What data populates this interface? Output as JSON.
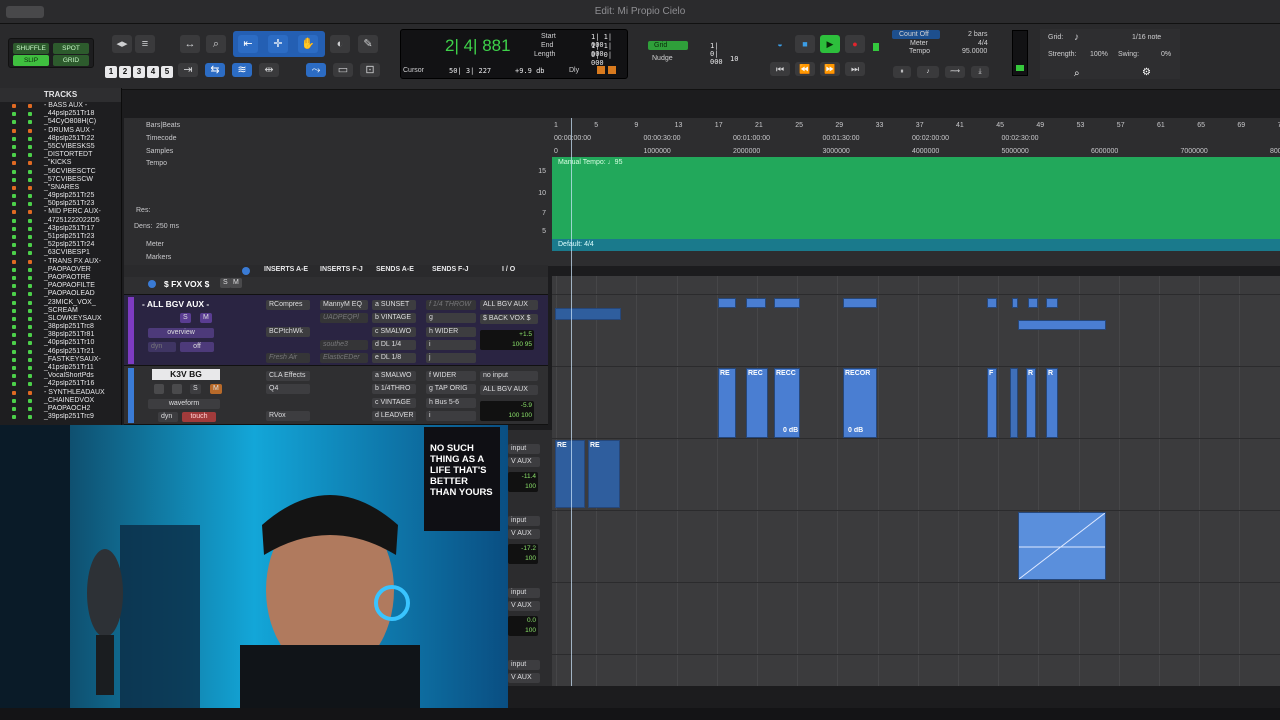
{
  "window": {
    "title": "Edit: Mi Propio Cielo"
  },
  "toolbar": {
    "modes": [
      "SHUFFLE",
      "SPOT",
      "SLIP",
      "GRID"
    ],
    "zoom_presets": [
      "1",
      "2",
      "3",
      "4",
      "5"
    ],
    "counter": {
      "main": "2| 4| 881",
      "cursor_label": "Cursor",
      "cursor_value": "50| 3| 227",
      "start_label": "Start",
      "start_value": "1| 1| 000",
      "end_label": "End",
      "end_value": "1| 1| 000",
      "length_label": "Length",
      "length_value": "0| 0| 000",
      "db_value": "+9.9 db",
      "dly_label": "Dly"
    },
    "grid": {
      "label": "Grid",
      "value": "1| 0| 000",
      "nudge_label": "Nudge",
      "nudge_value": "10"
    },
    "transport": {
      "count_off": "Count Off",
      "meter_label": "Meter",
      "tempo_label": "Tempo",
      "bars": "2 bars",
      "meter": "4/4",
      "tempo": "95.0000"
    },
    "grid_panel": {
      "grid_label": "Grid:",
      "grid_value": "1/16 note",
      "strength_label": "Strength:",
      "strength_value": "100%",
      "swing_label": "Swing:",
      "swing_value": "0%"
    }
  },
  "tracks_panel": {
    "title": "TRACKS",
    "items": [
      "- BASS AUX -",
      "_44pslp251Tr18",
      "_54CyO808H(C)",
      "- DRUMS AUX -",
      "_48pslp251Tr22",
      "_55CVIBESKS5",
      "_DISTORTEDT",
      "_\"KICKS",
      "_56CVIBESCTC",
      "_57CVIBESCW",
      "_\"SNARES",
      "_49pslp251Tr25",
      "_50pslp251Tr23",
      "- MID PERC AUX-",
      "_47251222022D5",
      "_43pslp251Tr17",
      "_51pslp251Tr23",
      "_52pslp251Tr24",
      "_63CVIBESP1",
      "- TRANS FX AUX-",
      "_PAOPAOVER",
      "_PAOPAOTRE",
      "_PAOPAOFILTE",
      "_PAOPAOLEAD",
      "_23MICK_VOX_",
      "_SCREAM",
      "_SLOWKEYSAUX",
      "_38pslp251Trc8",
      "_38pslp251Tr81",
      "_40pslp251Tr10",
      "_46pslp251Tr21",
      "_FASTKEYSAUX-",
      "_41pslp251Tr11",
      "_VocalShortPds",
      "_42pslp251Tr16",
      "- SYNTHLEADAUX",
      "_CHAINEDVOX",
      "_PAOPAOCH2",
      "_39pslp251Trc9"
    ]
  },
  "rulers": {
    "bars_beats": "Bars|Beats",
    "timecode": "Timecode",
    "samples": "Samples",
    "tempo": "Tempo",
    "meter": "Meter",
    "markers": "Markers",
    "res_label": "Res:",
    "dens_label": "Dens:",
    "dens_value": "250 ms",
    "bar_ticks": [
      "1",
      "5",
      "9",
      "13",
      "17",
      "21",
      "25",
      "29",
      "33",
      "37",
      "41",
      "45",
      "49",
      "53",
      "57",
      "61",
      "65",
      "69",
      "73"
    ],
    "tc_ticks": [
      "00:00:00:00",
      "00:00:30:00",
      "00:01:00:00",
      "00:01:30:00",
      "00:02:00:00",
      "00:02:30:00"
    ],
    "sample_ticks": [
      "0",
      "1000000",
      "2000000",
      "3000000",
      "4000000",
      "5000000",
      "6000000",
      "7000000",
      "8000000"
    ],
    "tempo_scale": [
      "15",
      "10",
      "7",
      "5"
    ],
    "tempo_marker": "Manual Tempo: ♩95",
    "meter_marker": "Default: 4/4"
  },
  "mix_header": {
    "inserts_ae": "INSERTS A-E",
    "inserts_fj": "INSERTS F-J",
    "sends_ae": "SENDS A-E",
    "sends_fj": "SENDS F-J",
    "io": "I / O"
  },
  "channels": [
    {
      "name": "$ FX VOX $",
      "s": "S",
      "m": "M"
    },
    {
      "name": "- ALL BGV AUX -",
      "s": "S",
      "m": "M",
      "view": "overview",
      "auto": "dyn",
      "auto2": "off",
      "inserts": [
        "RCompres",
        "BCPtchWk",
        "",
        "Fresh Air"
      ],
      "inserts_fj": [
        "MannyM EQ",
        "UADPEQPl",
        "southe3",
        "ElasticEDer"
      ],
      "sends": [
        "a SUNSET",
        "b VINTAGE",
        "c SMALWO",
        "d DL 1/4",
        "e DL 1/8"
      ],
      "sends_fj": [
        "f 1/4 THROW",
        "g",
        "h WIDER",
        "i",
        "j"
      ],
      "io": [
        "ALL BGV AUX",
        "$ BACK VOX $"
      ],
      "vol": "+1.5",
      "pan": "100 95"
    },
    {
      "name": "K3V BG",
      "s": "S",
      "m": "M",
      "view": "waveform",
      "auto": "dyn",
      "auto2": "touch",
      "inserts": [
        "CLA Effects",
        "Q4",
        "",
        "RVox"
      ],
      "sends": [
        "a SMALWO",
        "b 1/4THRO",
        "c VINTAGE",
        "d LEADVER"
      ],
      "sends_fj": [
        "f WIDER",
        "g TAP ORIG",
        "h Bus 5-6",
        "i"
      ],
      "io": [
        "no input",
        "ALL BGV AUX"
      ],
      "vol": "-5.9",
      "pan": "100 100"
    }
  ],
  "right_io": [
    {
      "label": "input",
      "aux": "V AUX",
      "vol": "-11.4",
      "pan": "100"
    },
    {
      "label": "input",
      "aux": "V AUX",
      "vol": "-17.2",
      "pan": "100"
    },
    {
      "label": "input",
      "aux": "V AUX",
      "vol": "0.0",
      "pan": "100"
    },
    {
      "label": "input",
      "aux": "V AUX"
    }
  ],
  "clips": [
    {
      "label": "RE"
    },
    {
      "label": "REC"
    },
    {
      "label": "RECC",
      "gain": "0 dB"
    },
    {
      "label": "RECOR",
      "gain": "0 dB"
    },
    {
      "label": "F"
    },
    {
      "label": "R"
    },
    {
      "label": "R"
    },
    {
      "label": "RE"
    },
    {
      "label": "RE"
    }
  ],
  "poster": {
    "text": "NO SUCH THING AS A LIFE THAT'S BETTER THAN YOURS"
  }
}
